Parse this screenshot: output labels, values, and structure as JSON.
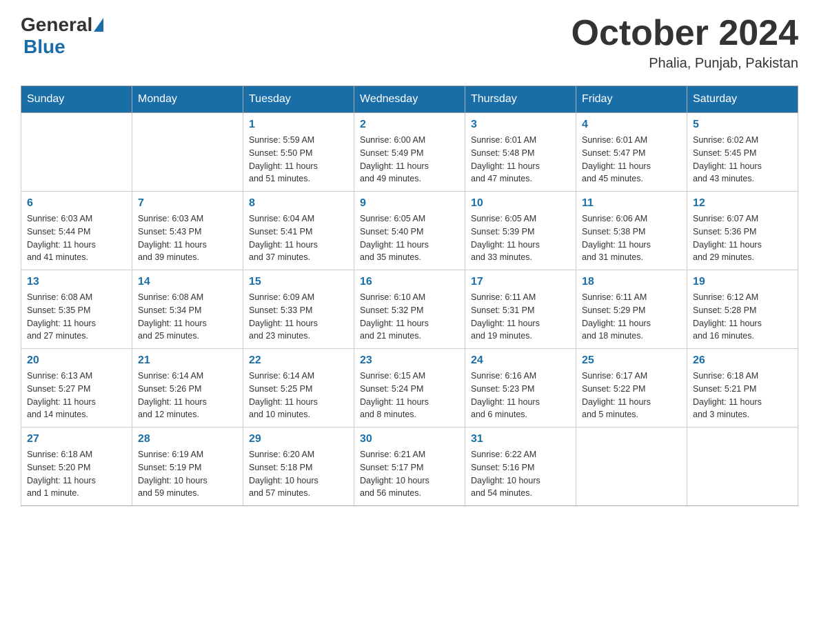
{
  "header": {
    "logo_general": "General",
    "logo_blue": "Blue",
    "title": "October 2024",
    "location": "Phalia, Punjab, Pakistan"
  },
  "weekdays": [
    "Sunday",
    "Monday",
    "Tuesday",
    "Wednesday",
    "Thursday",
    "Friday",
    "Saturday"
  ],
  "weeks": [
    [
      {
        "day": "",
        "info": ""
      },
      {
        "day": "",
        "info": ""
      },
      {
        "day": "1",
        "info": "Sunrise: 5:59 AM\nSunset: 5:50 PM\nDaylight: 11 hours\nand 51 minutes."
      },
      {
        "day": "2",
        "info": "Sunrise: 6:00 AM\nSunset: 5:49 PM\nDaylight: 11 hours\nand 49 minutes."
      },
      {
        "day": "3",
        "info": "Sunrise: 6:01 AM\nSunset: 5:48 PM\nDaylight: 11 hours\nand 47 minutes."
      },
      {
        "day": "4",
        "info": "Sunrise: 6:01 AM\nSunset: 5:47 PM\nDaylight: 11 hours\nand 45 minutes."
      },
      {
        "day": "5",
        "info": "Sunrise: 6:02 AM\nSunset: 5:45 PM\nDaylight: 11 hours\nand 43 minutes."
      }
    ],
    [
      {
        "day": "6",
        "info": "Sunrise: 6:03 AM\nSunset: 5:44 PM\nDaylight: 11 hours\nand 41 minutes."
      },
      {
        "day": "7",
        "info": "Sunrise: 6:03 AM\nSunset: 5:43 PM\nDaylight: 11 hours\nand 39 minutes."
      },
      {
        "day": "8",
        "info": "Sunrise: 6:04 AM\nSunset: 5:41 PM\nDaylight: 11 hours\nand 37 minutes."
      },
      {
        "day": "9",
        "info": "Sunrise: 6:05 AM\nSunset: 5:40 PM\nDaylight: 11 hours\nand 35 minutes."
      },
      {
        "day": "10",
        "info": "Sunrise: 6:05 AM\nSunset: 5:39 PM\nDaylight: 11 hours\nand 33 minutes."
      },
      {
        "day": "11",
        "info": "Sunrise: 6:06 AM\nSunset: 5:38 PM\nDaylight: 11 hours\nand 31 minutes."
      },
      {
        "day": "12",
        "info": "Sunrise: 6:07 AM\nSunset: 5:36 PM\nDaylight: 11 hours\nand 29 minutes."
      }
    ],
    [
      {
        "day": "13",
        "info": "Sunrise: 6:08 AM\nSunset: 5:35 PM\nDaylight: 11 hours\nand 27 minutes."
      },
      {
        "day": "14",
        "info": "Sunrise: 6:08 AM\nSunset: 5:34 PM\nDaylight: 11 hours\nand 25 minutes."
      },
      {
        "day": "15",
        "info": "Sunrise: 6:09 AM\nSunset: 5:33 PM\nDaylight: 11 hours\nand 23 minutes."
      },
      {
        "day": "16",
        "info": "Sunrise: 6:10 AM\nSunset: 5:32 PM\nDaylight: 11 hours\nand 21 minutes."
      },
      {
        "day": "17",
        "info": "Sunrise: 6:11 AM\nSunset: 5:31 PM\nDaylight: 11 hours\nand 19 minutes."
      },
      {
        "day": "18",
        "info": "Sunrise: 6:11 AM\nSunset: 5:29 PM\nDaylight: 11 hours\nand 18 minutes."
      },
      {
        "day": "19",
        "info": "Sunrise: 6:12 AM\nSunset: 5:28 PM\nDaylight: 11 hours\nand 16 minutes."
      }
    ],
    [
      {
        "day": "20",
        "info": "Sunrise: 6:13 AM\nSunset: 5:27 PM\nDaylight: 11 hours\nand 14 minutes."
      },
      {
        "day": "21",
        "info": "Sunrise: 6:14 AM\nSunset: 5:26 PM\nDaylight: 11 hours\nand 12 minutes."
      },
      {
        "day": "22",
        "info": "Sunrise: 6:14 AM\nSunset: 5:25 PM\nDaylight: 11 hours\nand 10 minutes."
      },
      {
        "day": "23",
        "info": "Sunrise: 6:15 AM\nSunset: 5:24 PM\nDaylight: 11 hours\nand 8 minutes."
      },
      {
        "day": "24",
        "info": "Sunrise: 6:16 AM\nSunset: 5:23 PM\nDaylight: 11 hours\nand 6 minutes."
      },
      {
        "day": "25",
        "info": "Sunrise: 6:17 AM\nSunset: 5:22 PM\nDaylight: 11 hours\nand 5 minutes."
      },
      {
        "day": "26",
        "info": "Sunrise: 6:18 AM\nSunset: 5:21 PM\nDaylight: 11 hours\nand 3 minutes."
      }
    ],
    [
      {
        "day": "27",
        "info": "Sunrise: 6:18 AM\nSunset: 5:20 PM\nDaylight: 11 hours\nand 1 minute."
      },
      {
        "day": "28",
        "info": "Sunrise: 6:19 AM\nSunset: 5:19 PM\nDaylight: 10 hours\nand 59 minutes."
      },
      {
        "day": "29",
        "info": "Sunrise: 6:20 AM\nSunset: 5:18 PM\nDaylight: 10 hours\nand 57 minutes."
      },
      {
        "day": "30",
        "info": "Sunrise: 6:21 AM\nSunset: 5:17 PM\nDaylight: 10 hours\nand 56 minutes."
      },
      {
        "day": "31",
        "info": "Sunrise: 6:22 AM\nSunset: 5:16 PM\nDaylight: 10 hours\nand 54 minutes."
      },
      {
        "day": "",
        "info": ""
      },
      {
        "day": "",
        "info": ""
      }
    ]
  ]
}
